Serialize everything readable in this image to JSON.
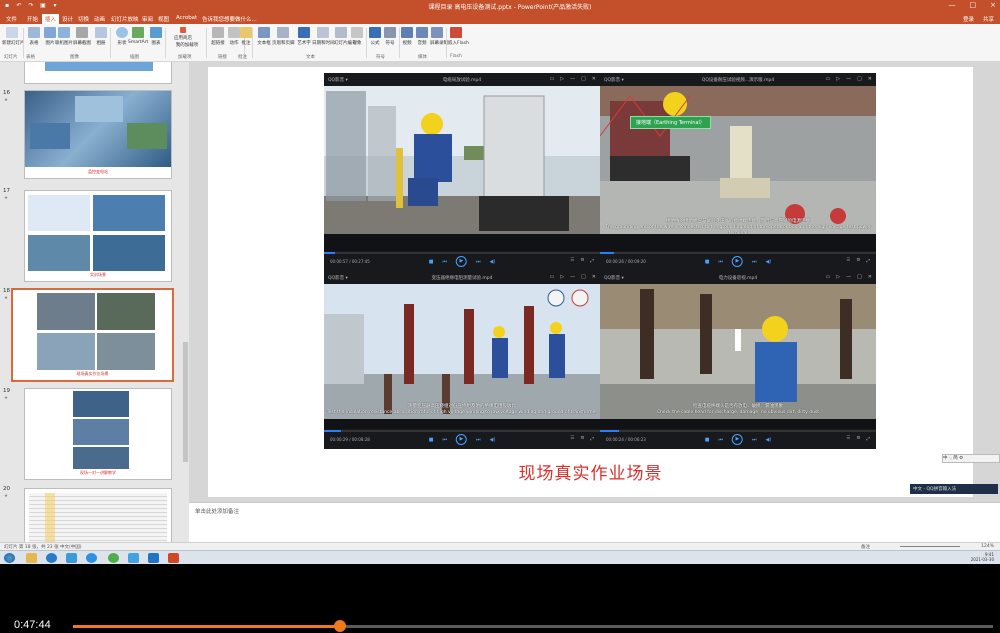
{
  "window": {
    "title": "课程目录 高电压设备测试.pptx - PowerPoint(产品激活失败)",
    "buttons": [
      "—",
      "□",
      "×"
    ]
  },
  "ribbon": {
    "tabs": [
      "文件",
      "开始",
      "插入",
      "设计",
      "切换",
      "动画",
      "幻灯片放映",
      "审阅",
      "视图",
      "Acrobat",
      "告诉我您想要做什么..."
    ],
    "active_tab": "插入",
    "login": "登录",
    "share": "共享",
    "groups": [
      "幻灯片",
      "表格",
      "图像",
      "插图",
      "加载项",
      "链接",
      "批注",
      "文本",
      "符号",
      "媒体",
      "Flash"
    ],
    "buttons": [
      "新建幻灯片",
      "表格",
      "图片",
      "联机图片",
      "屏幕截图",
      "相册",
      "形状",
      "SmartArt",
      "图表",
      "应用商店",
      "我的加载项",
      "超链接",
      "动作",
      "批注",
      "文本框",
      "页眉和页脚",
      "艺术字",
      "日期和时间",
      "幻灯片编号",
      "对象",
      "公式",
      "符号",
      "视频",
      "音频",
      "屏幕录制",
      "嵌入Flash"
    ]
  },
  "thumbnails": [
    {
      "number": "16",
      "caption": "监控变电站"
    },
    {
      "number": "17",
      "caption": "实训场景"
    },
    {
      "number": "18",
      "caption": "现场真实作业场景",
      "selected": true
    },
    {
      "number": "19",
      "caption": "现场一对一讲解教学"
    },
    {
      "number": "20",
      "caption": ""
    }
  ],
  "players": [
    {
      "app": "QQ影音 ▾",
      "file": "电缆局放试验.mp4",
      "time": "00:00:57 / 00:27:45",
      "progress": 0.04
    },
    {
      "app": "QQ影音 ▾",
      "file": "QQ设备耐压试验视频...演示版.mp4",
      "time": "00:00:26 / 00:09:20",
      "progress": 0.05,
      "label": "接地端（Earthing Terminal）",
      "subtitle_cn": "接地线的接地端应与试验变压器的接地端连接，而后与高压试验电源连接",
      "subtitle_en": "The grounding end of the wire is connected to the grounding end of the operator box and the high voltage test power terminal"
    },
    {
      "app": "QQ影音 ▾",
      "file": "变压器绝缘电阻测量试验.mp4",
      "time": "00:00:29 / 00:08:28",
      "progress": 0.06,
      "subtitle_cn": "测量变压器高压绕组对低压绕组及地的绝缘电阻吸收比",
      "subtitle_en": "Test the insulation resistance absorption ratio of high voltage winding to low voltage winding and ground of transformer"
    },
    {
      "app": "QQ影音 ▾",
      "file": "电力设备巡视.mp4",
      "time": "00:00:24 / 00:06:23",
      "progress": 0.07,
      "subtitle_cn": "检查电缆终端头是否有放电、破损、漏油现象",
      "subtitle_en": "Check the cable head for discharge, damage, no obvious dirt, dirty dust"
    }
  ],
  "slide": {
    "caption": "现场真实作业场景"
  },
  "notes_placeholder": "单击此处添加备注",
  "status": {
    "left": "幻灯片 第 18 张，共 23 张    中文(中国)",
    "notes": "备注",
    "zoom": "124%"
  },
  "taskbar": {
    "clock_time": "9:41",
    "clock_date": "2021-03-30"
  },
  "ime": "中 ·, 简 ⚙",
  "notification": "中文 - QQ拼音输入法",
  "video": {
    "current_time": "0:47:44",
    "progress": 0.29
  },
  "colors": {
    "accent": "#c4502b",
    "caption_red": "#d9302c",
    "player_blue": "#4aa0ff",
    "scrub_orange": "#f07a1a"
  }
}
